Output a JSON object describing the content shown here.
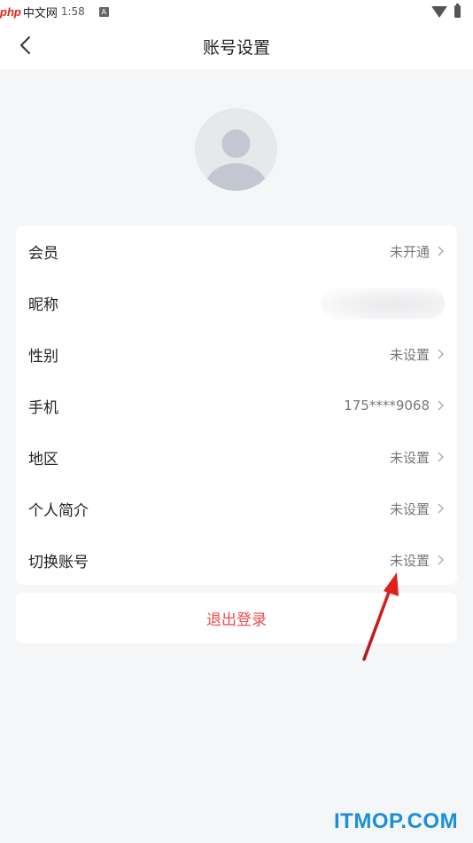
{
  "status_bar": {
    "watermark_brand": "php",
    "watermark_text": "中文网",
    "time": "1:58",
    "notification_icon": "A"
  },
  "nav": {
    "title": "账号设置",
    "back_icon": "chevron-left-icon"
  },
  "settings": {
    "items": [
      {
        "label": "会员",
        "value": "未开通"
      },
      {
        "label": "昵称",
        "value": ""
      },
      {
        "label": "性别",
        "value": "未设置"
      },
      {
        "label": "手机",
        "value": "175****9068"
      },
      {
        "label": "地区",
        "value": "未设置"
      },
      {
        "label": "个人简介",
        "value": "未设置"
      },
      {
        "label": "切换账号",
        "value": "未设置"
      }
    ]
  },
  "logout": {
    "label": "退出登录"
  },
  "colors": {
    "logout_red": "#f04a4a",
    "arrow_red": "#e0201e",
    "watermark_blue": "#1b8fd8",
    "background": "#f5f6f8"
  },
  "watermark_bottom": "ITMOP.COM"
}
